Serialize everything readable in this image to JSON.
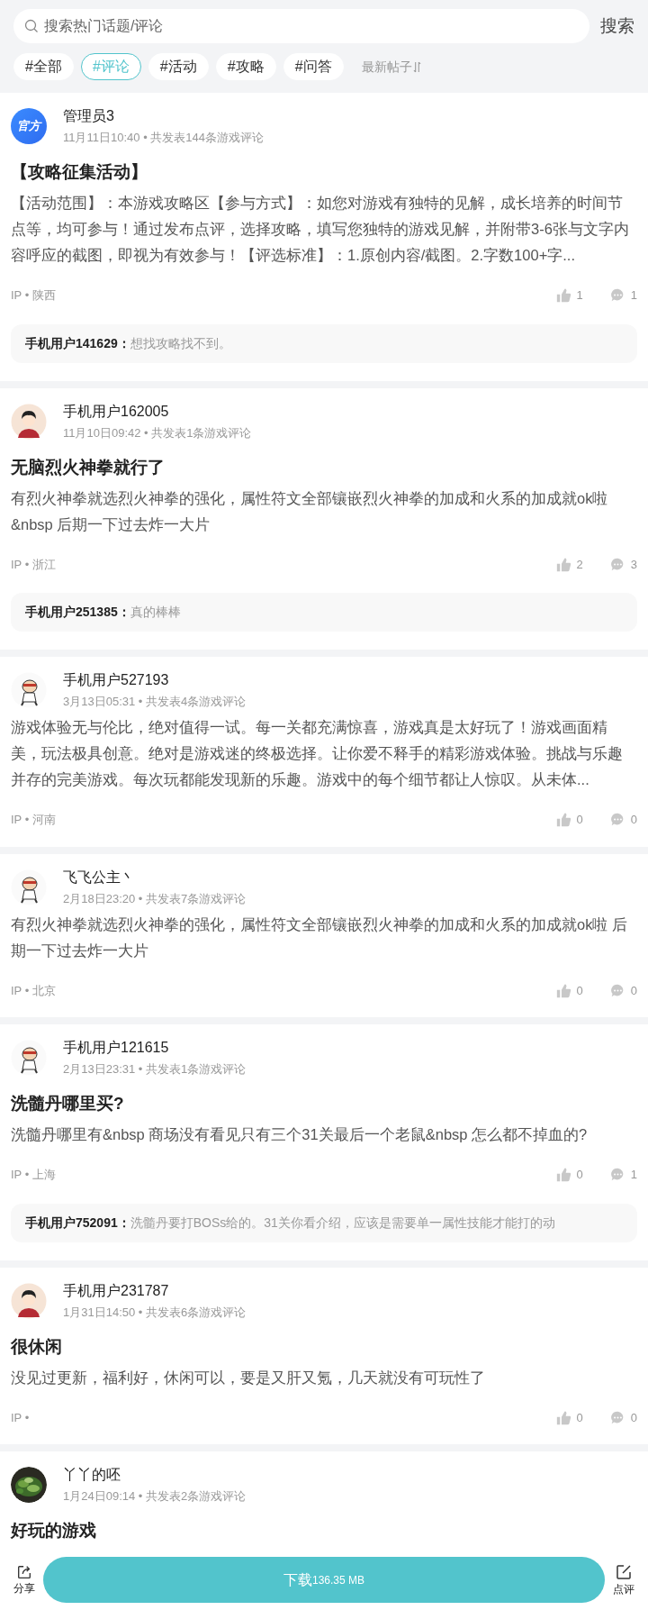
{
  "search": {
    "placeholder": "搜索热门话题/评论",
    "button": "搜索"
  },
  "tags": [
    {
      "label": "#全部",
      "selected": false
    },
    {
      "label": "#评论",
      "selected": true
    },
    {
      "label": "#活动",
      "selected": false
    },
    {
      "label": "#攻略",
      "selected": false
    },
    {
      "label": "#问答",
      "selected": false
    }
  ],
  "sort": "最新帖子",
  "posts": [
    {
      "avatar": {
        "kind": "official",
        "label": "官方"
      },
      "name": "管理员3",
      "meta": "11月11日10:40 • 共发表144条游戏评论",
      "title": "【攻略征集活动】",
      "body": "【活动范围】：本游戏攻略区【参与方式】：如您对游戏有独特的见解，成长培养的时间节点等，均可参与！通过发布点评，选择攻略，填写您独特的游戏见解，并附带3-6张与文字内容呼应的截图，即视为有效参与！【评选标准】：1.原创内容/截图。2.字数100+字...",
      "ip": "IP • 陕西",
      "likes": "1",
      "comments": "1",
      "reply": {
        "user": "手机用户141629：",
        "text": "想找攻略找不到。"
      }
    },
    {
      "avatar": {
        "kind": "person"
      },
      "name": "手机用户162005",
      "meta": "11月10日09:42 • 共发表1条游戏评论",
      "title": "无脑烈火神拳就行了",
      "body": "有烈火神拳就选烈火神拳的强化，属性符文全部镶嵌烈火神拳的加成和火系的加成就ok啦&nbsp 后期一下过去炸一大片",
      "ip": "IP • 浙江",
      "likes": "2",
      "comments": "3",
      "reply": {
        "user": "手机用户251385：",
        "text": "真的棒棒"
      }
    },
    {
      "avatar": {
        "kind": "cartoon"
      },
      "name": "手机用户527193",
      "meta": "3月13日05:31 • 共发表4条游戏评论",
      "body": "游戏体验无与伦比，绝对值得一试。每一关都充满惊喜，游戏真是太好玩了！游戏画面精美，玩法极具创意。绝对是游戏迷的终极选择。让你爱不释手的精彩游戏体验。挑战与乐趣并存的完美游戏。每次玩都能发现新的乐趣。游戏中的每个细节都让人惊叹。从未体...",
      "ip": "IP • 河南",
      "likes": "0",
      "comments": "0"
    },
    {
      "avatar": {
        "kind": "cartoon"
      },
      "name": "飞飞公主丶",
      "meta": "2月18日23:20 • 共发表7条游戏评论",
      "body": "有烈火神拳就选烈火神拳的强化，属性符文全部镶嵌烈火神拳的加成和火系的加成就ok啦 后期一下过去炸一大片",
      "ip": "IP • 北京",
      "likes": "0",
      "comments": "0"
    },
    {
      "avatar": {
        "kind": "cartoon"
      },
      "name": "手机用户121615",
      "meta": "2月13日23:31 • 共发表1条游戏评论",
      "title": "洗髓丹哪里买?",
      "body": "洗髓丹哪里有&nbsp 商场没有看见只有三个31关最后一个老鼠&nbsp 怎么都不掉血的?",
      "ip": "IP • 上海",
      "likes": "0",
      "comments": "1",
      "reply": {
        "user": "手机用户752091：",
        "text": "洗髓丹要打BOSs给的。31关你看介绍，应该是需要单一属性技能才能打的动"
      }
    },
    {
      "avatar": {
        "kind": "person"
      },
      "name": "手机用户231787",
      "meta": "1月31日14:50 • 共发表6条游戏评论",
      "title": "很休闲",
      "body": "没见过更新，福利好，休闲可以，要是又肝又氪，几天就没有可玩性了",
      "ip": "IP •",
      "likes": "0",
      "comments": "0"
    },
    {
      "name": "丫丫的呸",
      "meta": "1月24日09:14 • 共发表2条游戏评论",
      "title": "好玩的游戏"
    }
  ],
  "bottom": {
    "share": "分享",
    "download": "下载",
    "size": "136.35 MB",
    "review": "点评"
  }
}
